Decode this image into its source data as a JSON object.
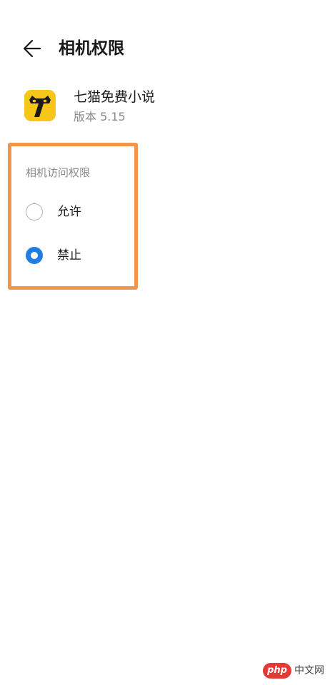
{
  "header": {
    "title": "相机权限",
    "back_icon": "arrow-left-icon"
  },
  "app": {
    "name": "七猫免费小说",
    "version": "版本 5.15",
    "icon": "cat-seven-icon",
    "icon_color": "#f6c61a"
  },
  "permission": {
    "section_label": "相机访问权限",
    "options": [
      {
        "label": "允许",
        "selected": false
      },
      {
        "label": "禁止",
        "selected": true
      }
    ],
    "highlight_color": "#f0954a",
    "accent_color": "#1f7ee0"
  },
  "watermark": {
    "badge": "php",
    "text": "中文网"
  }
}
